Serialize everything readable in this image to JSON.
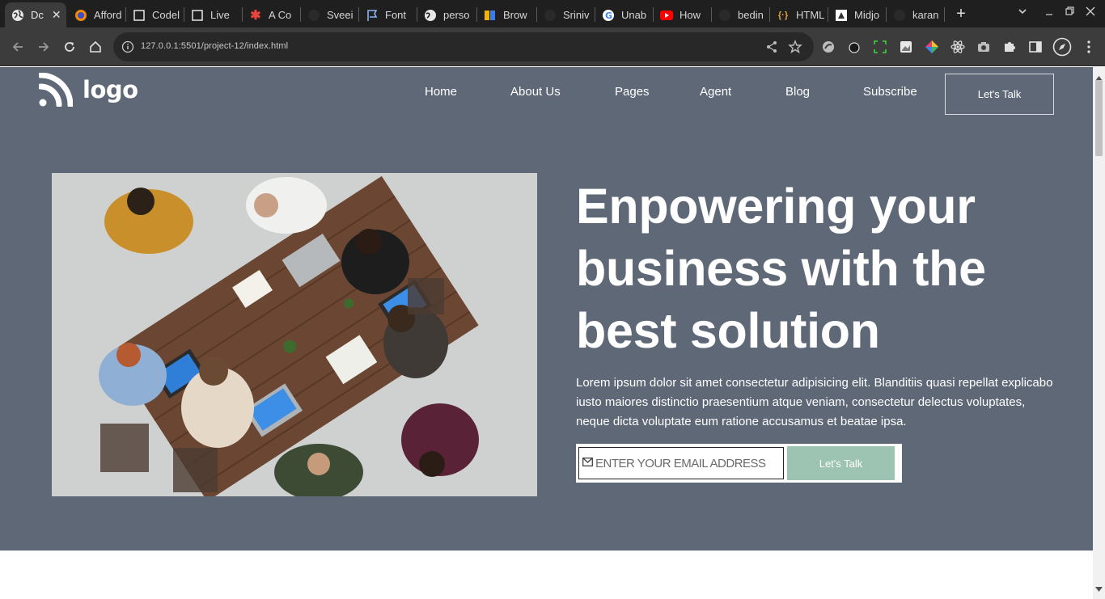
{
  "browser": {
    "tabs": [
      {
        "title": "Dc",
        "icon": "globe-icon",
        "active": true
      },
      {
        "title": "Afford",
        "icon": "firefox-icon"
      },
      {
        "title": "Codel",
        "icon": "codepen-icon"
      },
      {
        "title": "Live",
        "icon": "codepen-icon"
      },
      {
        "title": "A Co",
        "icon": "asterisk-icon"
      },
      {
        "title": "Sveei",
        "icon": "github-icon"
      },
      {
        "title": "Font",
        "icon": "flag-icon"
      },
      {
        "title": "perso",
        "icon": "globe-icon"
      },
      {
        "title": "Brow",
        "icon": "browserstack-icon"
      },
      {
        "title": "Sriniv",
        "icon": "github-icon"
      },
      {
        "title": "Unab",
        "icon": "google-icon"
      },
      {
        "title": "How",
        "icon": "youtube-icon"
      },
      {
        "title": "bedin",
        "icon": "github-icon"
      },
      {
        "title": "HTML",
        "icon": "code-braces-icon"
      },
      {
        "title": "Midjo",
        "icon": "midjourney-icon"
      },
      {
        "title": "karan",
        "icon": "github-icon"
      }
    ],
    "url": "127.0.0.1:5501/project-12/index.html",
    "accent": "#8ab4f8"
  },
  "site": {
    "logo_text": "logo",
    "nav": [
      "Home",
      "About Us",
      "Pages",
      "Agent",
      "Blog",
      "Subscribe"
    ],
    "nav_cta": "Let's Talk",
    "headline": "Enpowering your business with the best solution",
    "description": "Lorem ipsum dolor sit amet consectetur adipisicing elit. Blanditiis quasi repellat explicabo iusto maiores distinctio praesentium atque veniam, consectetur delectus voluptates, neque dicta voluptate eum ratione accusamus et beatae ipsa.",
    "email_placeholder": "ENTER YOUR EMAIL ADDRESS",
    "submit_label": "Let's Talk",
    "colors": {
      "hero_bg": "#5f6876",
      "button_green": "#9dc3b2"
    }
  }
}
